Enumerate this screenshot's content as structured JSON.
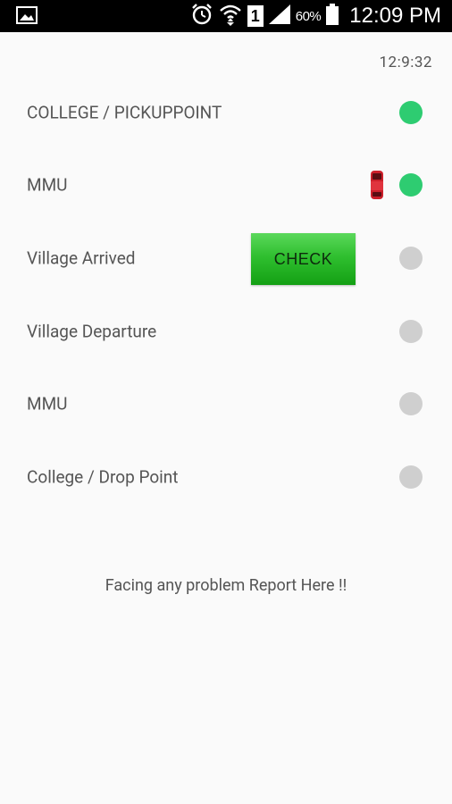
{
  "status_bar": {
    "left_icon": "gallery-icon",
    "icons": [
      "alarm-icon",
      "wifi-icon",
      "sim-1-icon",
      "signal-icon",
      "battery-icon"
    ],
    "sim_label": "1",
    "battery_pct": "60%",
    "time": "12:09 PM"
  },
  "clock": "12:9:32",
  "stops": [
    {
      "label": "COLLEGE  / PICKUPPOINT",
      "reached": true
    },
    {
      "label": "MMU",
      "reached": true,
      "bus_here": true
    },
    {
      "label": "Village Arrived",
      "reached": false
    },
    {
      "label": "Village Departure",
      "reached": false
    },
    {
      "label": "MMU",
      "reached": false
    },
    {
      "label": "College / Drop Point",
      "reached": false
    }
  ],
  "check_button": "CHECK",
  "report_link": "Facing any problem Report Here !!",
  "colors": {
    "active_dot": "#2ecc71",
    "inactive_dot": "#cfcfcf",
    "button_green": "#2fbf2f",
    "bus_red": "#cc1f2a"
  }
}
